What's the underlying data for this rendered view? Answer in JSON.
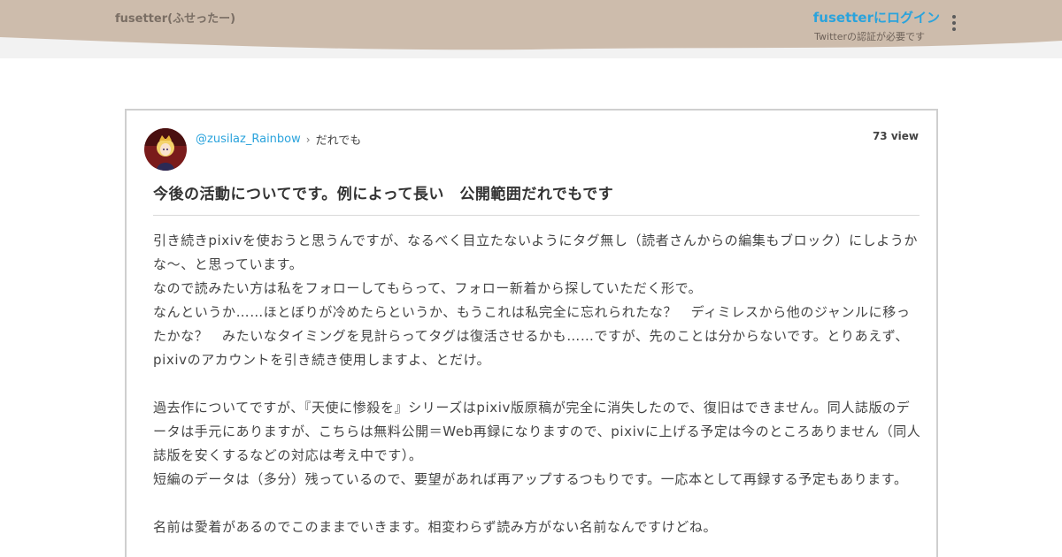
{
  "header": {
    "brand": "fusetter(ふせったー)",
    "login_label": "fusetterにログイン",
    "login_note": "Twitterの認証が必要です",
    "menu_icon": "vertical-dots-icon",
    "bg_color": "#cdbcac"
  },
  "post": {
    "user": "@zusilaz_Rainbow",
    "separator_icon": "chevron-right-icon",
    "audience": "だれでも",
    "views": "73 view",
    "title": "今後の活動についてです。例によって長い　公開範囲だれでもです",
    "body": [
      "引き続きpixivを使おうと思うんですが、なるべく目立たないようにタグ無し（読者さんからの編集もブロック）にしようかな〜、と思っています。",
      "なので読みたい方は私をフォローしてもらって、フォロー新着から探していただく形で。",
      "なんというか……ほとぼりが冷めたらというか、もうこれは私完全に忘れられたな？　ディミレスから他のジャンルに移ったかな？　みたいなタイミングを見計らってタグは復活させるかも……ですが、先のことは分からないです。とりあえず、pixivのアカウントを引き続き使用しますよ、とだけ。",
      "",
      "過去作についてですが、『天使に惨殺を』シリーズはpixiv版原稿が完全に消失したので、復旧はできません。同人誌版のデータは手元にありますが、こちらは無料公開＝Web再録になりますので、pixivに上げる予定は今のところありません（同人誌版を安くするなどの対応は考え中です）。",
      "短編のデータは（多分）残っているので、要望があれば再アップするつもりです。一応本として再録する予定もあります。",
      "",
      "名前は愛着があるのでこのままでいきます。相変わらず読み方がない名前なんですけどね。"
    ],
    "link_color": "#2aa3dc"
  }
}
